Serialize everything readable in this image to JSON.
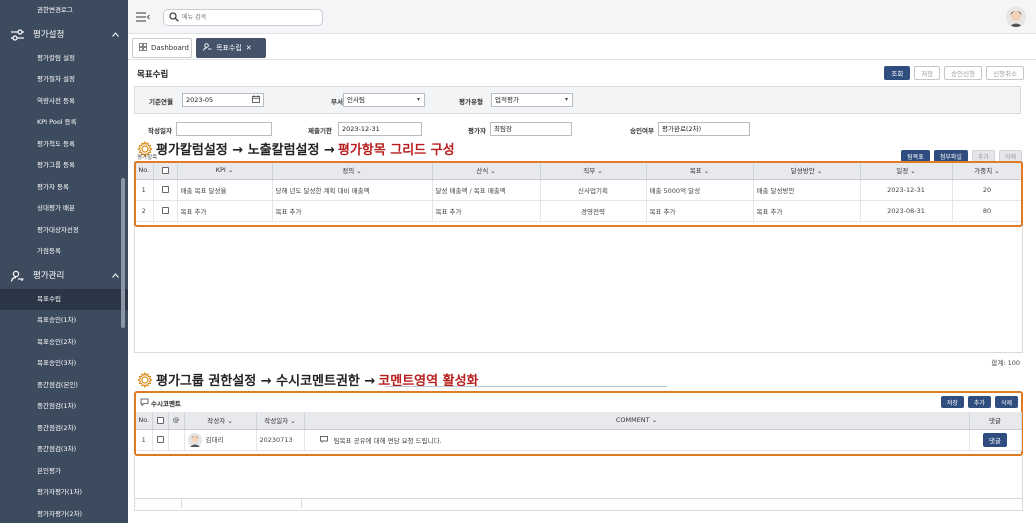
{
  "sidebar": {
    "items_top": [
      "권한변경로그"
    ],
    "group1": {
      "label": "평가설정",
      "caret": "^"
    },
    "group1_items": [
      "평가칼럼 설정",
      "평가절차 설정",
      "역량사전 등록",
      "KPI Pool 등록",
      "평가척도 등록",
      "평가그룹 등록",
      "평가자 등록",
      "상대평가 배분",
      "평가대상자선정",
      "가점등록"
    ],
    "group2": {
      "label": "평가관리",
      "caret": "^"
    },
    "group2_items": [
      "목표수립",
      "목표승인(1차)",
      "목표승인(2차)",
      "목표승인(3차)",
      "중간점검(본인)",
      "중간점검(1차)",
      "중간점검(2차)",
      "중간점검(3차)",
      "본인평가",
      "평가자평가(1차)",
      "평가자평가(2차)"
    ],
    "active_item": "목표수립"
  },
  "topbar": {
    "search_placeholder": "메뉴 검색"
  },
  "tabs": [
    {
      "label": "Dashboard"
    },
    {
      "label": "목표수립",
      "close": "✕"
    }
  ],
  "page": {
    "title": "목표수립",
    "buttons": [
      "조회",
      "저장",
      "승인신청",
      "신청취소"
    ]
  },
  "filters": {
    "base_month_label": "기준연월",
    "base_month_value": "2023-05",
    "dept_label": "부서",
    "dept_value": "인사팀",
    "eval_type_label": "평가유형",
    "eval_type_value": "업적평가",
    "write_date_label": "작성일자",
    "write_date_value": "",
    "due_label": "제출기한",
    "due_value": "2023-12-31",
    "evaluator_label": "평가자",
    "evaluator_value": "최팀장",
    "approval_label": "승인여부",
    "approval_value": "평가완료(2차)"
  },
  "annotation1": {
    "part1": "평가칼럼설정 → 노출칼럼설정 → ",
    "part2": "평가항목 그리드 구성",
    "small_label": "평가항목"
  },
  "annotation2": {
    "part1": "평가그룹 권한설정 → 수시코멘트권한 → ",
    "part2": "코멘트영역 활성화"
  },
  "grid": {
    "tool_buttons": [
      "팀목표",
      "첨부파일",
      "추가",
      "삭제"
    ],
    "headers": [
      "No.",
      "",
      "KPI ⌄",
      "정의 ⌄",
      "산식 ⌄",
      "직무 ⌄",
      "목표 ⌄",
      "달성방안 ⌄",
      "일정 ⌄",
      "가중치 ⌄"
    ],
    "rows": [
      {
        "no": "1",
        "kpi": "매출 목표 달성율",
        "def": "당해 년도 달성한 계획 대비 매출액",
        "formula": "달성 매출액 / 목표 매출액",
        "job": "신사업기획",
        "goal": "매출 5000억 달성",
        "plan": "매출 달성방안",
        "date": "2023-12-31",
        "weight": "20"
      },
      {
        "no": "2",
        "kpi": "목표 추가",
        "def": "목표 추가",
        "formula": "목표 추가",
        "job": "경영전략",
        "goal": "목표 추가",
        "plan": "목표 추가",
        "date": "2023-08-31",
        "weight": "80"
      }
    ],
    "total": "합계: 100"
  },
  "comments": {
    "title": "수시코멘트",
    "tool_buttons": [
      "저장",
      "추가",
      "삭제"
    ],
    "headers": [
      "No.",
      "",
      "@",
      "작성자 ⌄",
      "작성일자 ⌄",
      "COMMENT ⌄",
      "댓글"
    ],
    "rows": [
      {
        "no": "1",
        "author": "김대리",
        "date": "20230713",
        "comment": "팀목표 공유에 대해 면담 요청 드립니다.",
        "reply": "댓글"
      }
    ]
  },
  "colors": {
    "sidebar_bg": "#3d4b5e",
    "primary": "#2f4d7e",
    "highlight_border": "#e07a25",
    "annotation_red": "#b81d1d"
  }
}
